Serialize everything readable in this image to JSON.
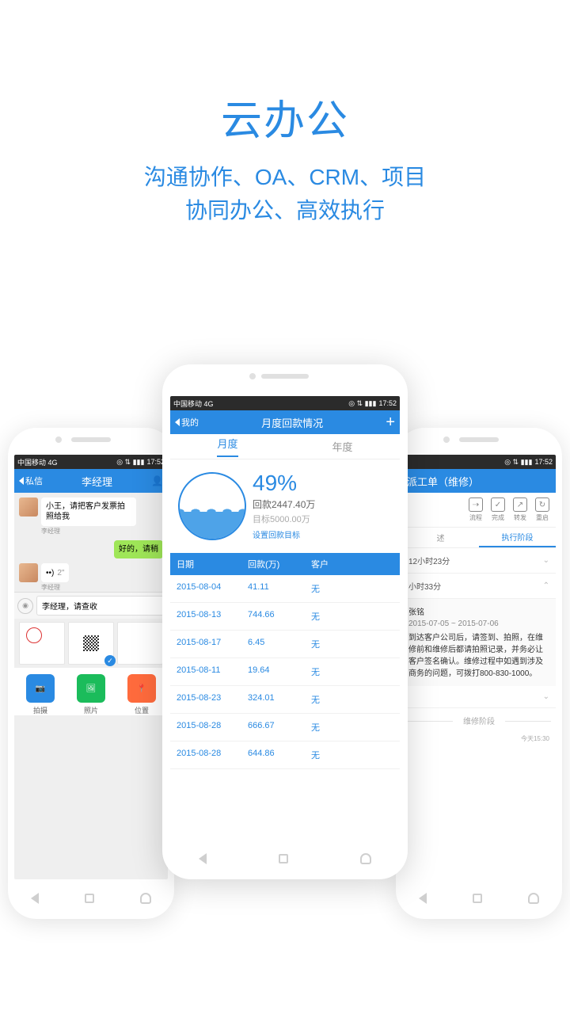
{
  "hero": {
    "title": "云办公",
    "subtitle_l1": "沟通协作、OA、CRM、项目",
    "subtitle_l2": "协同办公、高效执行"
  },
  "statusbar": {
    "carrier": "中国移动 4G",
    "time": "17:52"
  },
  "left": {
    "back": "私信",
    "title": "李经理",
    "msg1": "小王，请把客户发票拍照给我",
    "sender": "李经理",
    "msg2": "好的，请稍",
    "voice_len": "2\"",
    "input": "李经理，请查收",
    "actions": {
      "shoot": "拍摄",
      "photo": "照片",
      "location": "位置"
    }
  },
  "center": {
    "back": "我的",
    "title": "月度回款情况",
    "tabs": {
      "month": "月度",
      "year": "年度"
    },
    "pct": "49%",
    "amount": "回款2447.40万",
    "target": "目标5000.00万",
    "set_link": "设置回款目标",
    "headers": {
      "date": "日期",
      "amount": "回款(万)",
      "customer": "客户"
    },
    "rows": [
      {
        "date": "2015-08-04",
        "amount": "41.11",
        "customer": "无"
      },
      {
        "date": "2015-08-13",
        "amount": "744.66",
        "customer": "无"
      },
      {
        "date": "2015-08-17",
        "amount": "6.45",
        "customer": "无"
      },
      {
        "date": "2015-08-11",
        "amount": "19.64",
        "customer": "无"
      },
      {
        "date": "2015-08-23",
        "amount": "324.01",
        "customer": "无"
      },
      {
        "date": "2015-08-28",
        "amount": "666.67",
        "customer": "无"
      },
      {
        "date": "2015-08-28",
        "amount": "644.86",
        "customer": "无"
      }
    ]
  },
  "right": {
    "title": "派工单（维修）",
    "toolbar": {
      "flow": "流程",
      "done": "完成",
      "forward": "转发",
      "restart": "重启"
    },
    "tab_desc": "述",
    "tab_phase": "执行阶段",
    "row1": "12小时23分",
    "row2": "小时33分",
    "name": "张铭",
    "dates": "2015-07-05 ~ 2015-07-06",
    "desc": "到达客户公司后，请签到、拍照，在维修前和维修后都请拍照记录，并务必让客户签名确认。维修过程中如遇到涉及商务的问题，可拨打800-830-1000。",
    "phase": "维修阶段",
    "ts": "今天15:30"
  }
}
